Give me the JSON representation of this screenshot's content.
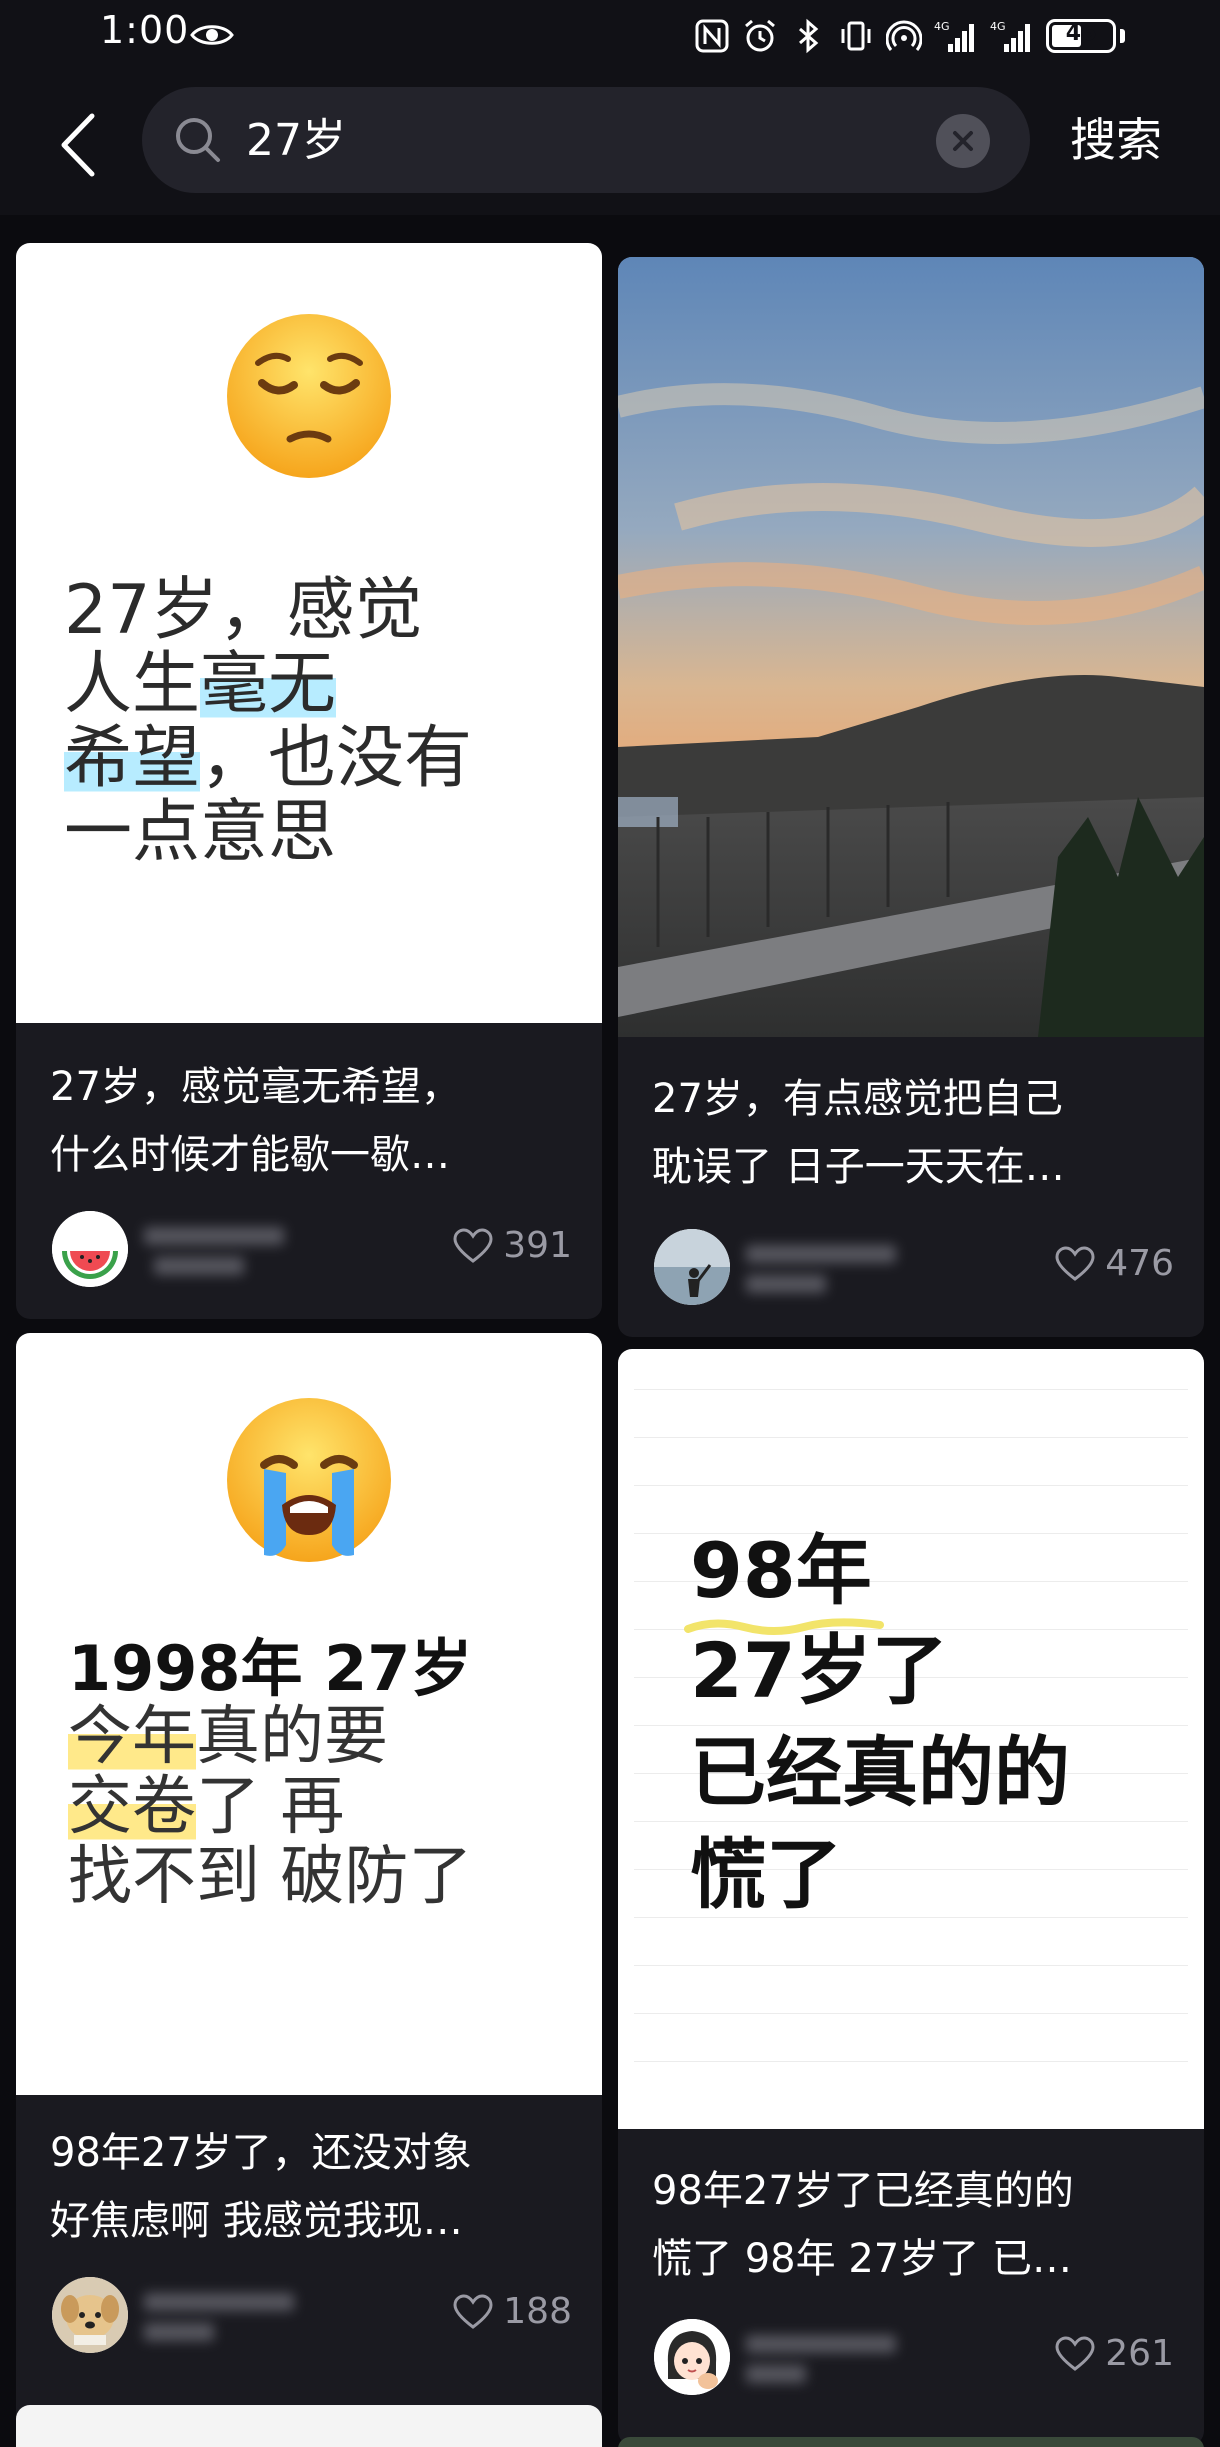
{
  "status_bar": {
    "time": "1:00",
    "battery": "46",
    "network_a": "4G",
    "network_b": "4G"
  },
  "search": {
    "back_icon": "chevron-left-icon",
    "query": "27岁",
    "clear_icon": "close-icon",
    "submit_label": "搜索"
  },
  "cards": [
    {
      "cover": {
        "emoji": "pensive-face",
        "lines": [
          "27岁，感觉",
          "人生",
          "毫无",
          "希望",
          "，也没有",
          "一点意思"
        ]
      },
      "title_line1": "27岁，感觉毫无希望，",
      "title_line2": "什么时候才能歇一歇…",
      "likes": "391",
      "avatar": "watermelon"
    },
    {
      "cover": {
        "description_kind": "photo"
      },
      "title_line1": "27岁，有点感觉把自己",
      "title_line2": "耽误了 日子一天天在…",
      "likes": "476",
      "avatar": "person-at-sea"
    },
    {
      "cover": {
        "emoji": "crying-face",
        "lines": [
          "1998年 27岁",
          "今年",
          "真的要",
          "交卷",
          "了 再",
          "找不到 破防了"
        ]
      },
      "title_line1": "98年27岁了，还没对象",
      "title_line2": "好焦虑啊 我感觉我现…",
      "likes": "188",
      "avatar": "dog"
    },
    {
      "cover": {
        "lines": [
          "98年",
          "27岁了",
          "已经真的的",
          "慌了"
        ]
      },
      "title_line1": "98年27岁了已经真的的",
      "title_line2": "慌了 98年 27岁了 已…",
      "likes": "261",
      "avatar": "cartoon-girl"
    }
  ],
  "colors": {
    "background": "#0b0b0f",
    "card": "#1a1a20",
    "search_box": "#23232b",
    "highlight_blue": "#b7ecff",
    "highlight_yellow": "#ffe98a",
    "accent_orange": "#f08a24"
  }
}
